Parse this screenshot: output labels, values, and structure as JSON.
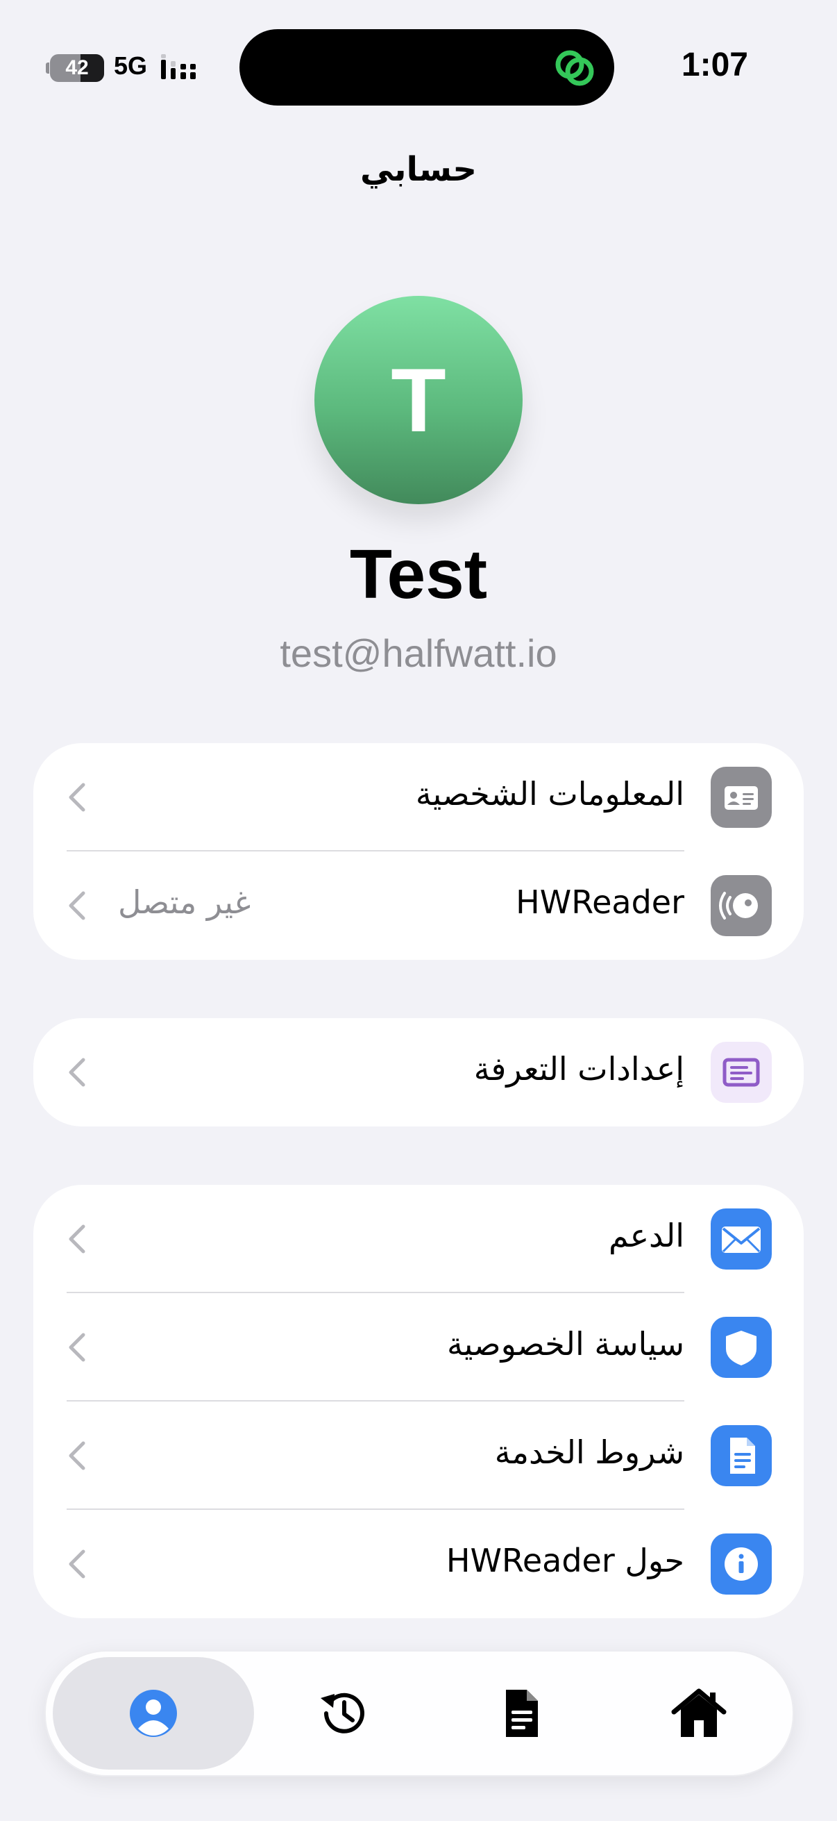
{
  "status_bar": {
    "battery": "42",
    "network": "5G",
    "time": "1:07"
  },
  "header": {
    "title": "حسابي"
  },
  "profile": {
    "initial": "T",
    "name": "Test",
    "email": "test@halfwatt.io",
    "avatar_color": "#5cb97d"
  },
  "groups": [
    {
      "items": [
        {
          "label": "المعلومات الشخصية",
          "icon": "id-card-icon",
          "icon_color": "#8e8e93"
        },
        {
          "label": "HWReader",
          "value": "غير متصل",
          "icon": "reader-device-icon",
          "icon_color": "#8e8e93"
        }
      ]
    },
    {
      "items": [
        {
          "label": "إعدادات التعرفة",
          "icon": "tariff-icon",
          "icon_color": "#8f5cc7"
        }
      ]
    },
    {
      "items": [
        {
          "label": "الدعم",
          "icon": "envelope-icon",
          "icon_color": "#3a86f0"
        },
        {
          "label": "سياسة الخصوصية",
          "icon": "shield-icon",
          "icon_color": "#3a86f0"
        },
        {
          "label": "شروط الخدمة",
          "icon": "document-icon",
          "icon_color": "#3a86f0"
        },
        {
          "label": "حول HWReader",
          "icon": "info-icon",
          "icon_color": "#3a86f0"
        }
      ]
    }
  ],
  "tab_bar": {
    "tabs": [
      {
        "icon": "person-icon",
        "active": true,
        "color": "#3a86f0"
      },
      {
        "icon": "history-icon",
        "active": false,
        "color": "#000000"
      },
      {
        "icon": "document-icon",
        "active": false,
        "color": "#000000"
      },
      {
        "icon": "home-icon",
        "active": false,
        "color": "#000000"
      }
    ]
  }
}
